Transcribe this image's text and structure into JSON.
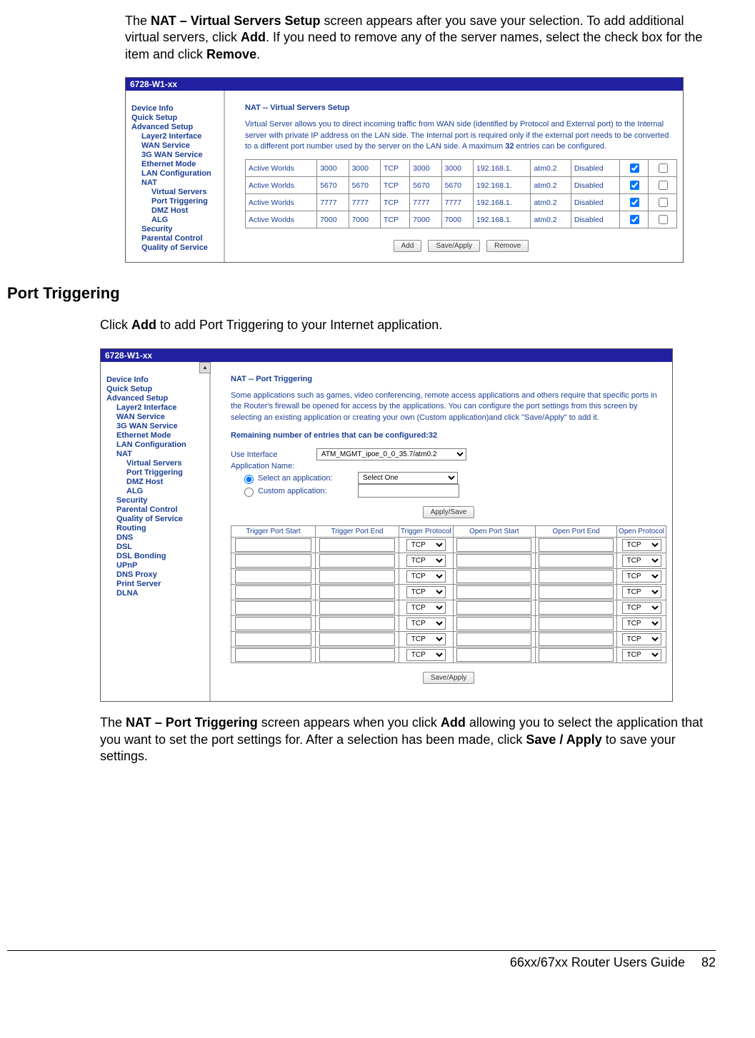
{
  "doc": {
    "para1_a": "The ",
    "para1_b_bold": "NAT – Virtual Servers Setup",
    "para1_c": " screen appears after you save your selection. To add additional virtual servers, click ",
    "para1_d_bold": "Add",
    "para1_e": ". If you need to remove any of the server names, select the check box for the item and click ",
    "para1_f_bold": "Remove",
    "para1_g": ".",
    "section_heading": "Port Triggering",
    "para2_a": "Click ",
    "para2_b_bold": "Add",
    "para2_c": " to add Port Triggering to your Internet application.",
    "para3_a": "The ",
    "para3_b_bold": "NAT – Port Triggering",
    "para3_c": " screen appears when you click ",
    "para3_d_bold": "Add",
    "para3_e": " allowing you to select the application that you want to set the port settings for. After a selection has been made, click ",
    "para3_f_bold": "Save / Apply",
    "para3_g": " to save your settings.",
    "footer_title": "66xx/67xx Router Users Guide",
    "footer_page": "82"
  },
  "shot1": {
    "window_title": "6728-W1-xx",
    "sidebar": [
      {
        "lvl": 1,
        "label": "Device Info"
      },
      {
        "lvl": 1,
        "label": "Quick Setup"
      },
      {
        "lvl": 1,
        "label": "Advanced Setup"
      },
      {
        "lvl": 2,
        "label": "Layer2 Interface"
      },
      {
        "lvl": 2,
        "label": "WAN Service"
      },
      {
        "lvl": 2,
        "label": "3G WAN Service"
      },
      {
        "lvl": 2,
        "label": "Ethernet Mode"
      },
      {
        "lvl": 2,
        "label": "LAN Configuration"
      },
      {
        "lvl": 2,
        "label": "NAT"
      },
      {
        "lvl": 3,
        "label": "Virtual Servers"
      },
      {
        "lvl": 3,
        "label": "Port Triggering"
      },
      {
        "lvl": 3,
        "label": "DMZ Host"
      },
      {
        "lvl": 3,
        "label": "ALG"
      },
      {
        "lvl": 2,
        "label": "Security"
      },
      {
        "lvl": 2,
        "label": "Parental Control"
      },
      {
        "lvl": 2,
        "label": "Quality of Service"
      }
    ],
    "panel_title": "NAT -- Virtual Servers Setup",
    "desc_a": "Virtual Server allows you to direct incoming traffic from WAN side (identified by Protocol and External port) to the Internal server with private IP address on the LAN side. The Internal port is required only if the external port needs to be converted to a different port number used by the server on the LAN side. A maximum ",
    "desc_b_bold": "32",
    "desc_c": " entries can be configured.",
    "rows": [
      {
        "name": "Active Worlds",
        "c2": "3000",
        "c3": "3000",
        "proto": "TCP",
        "c5": "3000",
        "c6": "3000",
        "ip": "192.168.1.",
        "iface": "atm0.2",
        "state": "Disabled"
      },
      {
        "name": "Active Worlds",
        "c2": "5670",
        "c3": "5670",
        "proto": "TCP",
        "c5": "5670",
        "c6": "5670",
        "ip": "192.168.1.",
        "iface": "atm0.2",
        "state": "Disabled"
      },
      {
        "name": "Active Worlds",
        "c2": "7777",
        "c3": "7777",
        "proto": "TCP",
        "c5": "7777",
        "c6": "7777",
        "ip": "192.168.1.",
        "iface": "atm0.2",
        "state": "Disabled"
      },
      {
        "name": "Active Worlds",
        "c2": "7000",
        "c3": "7000",
        "proto": "TCP",
        "c5": "7000",
        "c6": "7000",
        "ip": "192.168.1.",
        "iface": "atm0.2",
        "state": "Disabled"
      }
    ],
    "buttons": {
      "add": "Add",
      "save": "Save/Apply",
      "remove": "Remove"
    }
  },
  "shot2": {
    "window_title": "6728-W1-xx",
    "sidebar": [
      {
        "lvl": 1,
        "label": "Device Info"
      },
      {
        "lvl": 1,
        "label": "Quick Setup"
      },
      {
        "lvl": 1,
        "label": "Advanced Setup"
      },
      {
        "lvl": 2,
        "label": "Layer2 Interface"
      },
      {
        "lvl": 2,
        "label": "WAN Service"
      },
      {
        "lvl": 2,
        "label": "3G WAN Service"
      },
      {
        "lvl": 2,
        "label": "Ethernet Mode"
      },
      {
        "lvl": 2,
        "label": "LAN Configuration"
      },
      {
        "lvl": 2,
        "label": "NAT"
      },
      {
        "lvl": 3,
        "label": "Virtual Servers"
      },
      {
        "lvl": 3,
        "label": "Port Triggering"
      },
      {
        "lvl": 3,
        "label": "DMZ Host"
      },
      {
        "lvl": 3,
        "label": "ALG"
      },
      {
        "lvl": 2,
        "label": "Security"
      },
      {
        "lvl": 2,
        "label": "Parental Control"
      },
      {
        "lvl": 2,
        "label": "Quality of Service"
      },
      {
        "lvl": 2,
        "label": "Routing"
      },
      {
        "lvl": 2,
        "label": "DNS"
      },
      {
        "lvl": 2,
        "label": "DSL"
      },
      {
        "lvl": 2,
        "label": "DSL Bonding"
      },
      {
        "lvl": 2,
        "label": "UPnP"
      },
      {
        "lvl": 2,
        "label": "DNS Proxy"
      },
      {
        "lvl": 2,
        "label": "Print Server"
      },
      {
        "lvl": 2,
        "label": "DLNA"
      }
    ],
    "panel_title": "NAT -- Port Triggering",
    "desc": "Some applications such as games, video conferencing, remote access applications and others require that specific ports in the Router's firewall be opened for access by the applications. You can configure the port settings from this screen by selecting an existing application or creating your own (Custom application)and click \"Save/Apply\" to add it.",
    "remaining_label": "Remaining number of entries that can be configured:32",
    "use_interface_label": "Use Interface",
    "use_interface_value": "ATM_MGMT_ipoe_0_0_35.7/atm0.2",
    "appname_label": "Application Name:",
    "radio_select_label": "Select an application:",
    "radio_select_value": "Select One",
    "radio_custom_label": "Custom application:",
    "apply_save_label": "Apply/Save",
    "headers": [
      "Trigger Port Start",
      "Trigger Port End",
      "Trigger Protocol",
      "Open Port Start",
      "Open Port End",
      "Open Protocol"
    ],
    "proto_default": "TCP",
    "row_count": 8,
    "save_apply_label": "Save/Apply"
  }
}
